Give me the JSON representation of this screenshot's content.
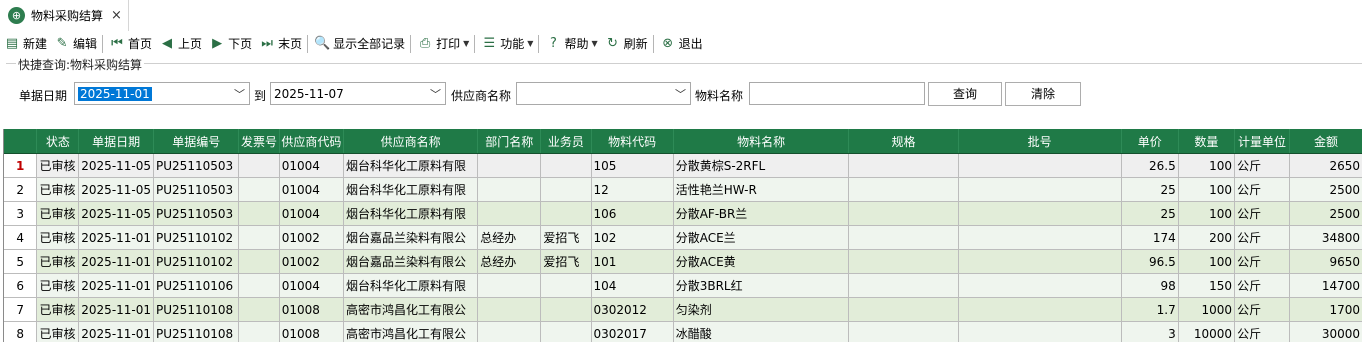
{
  "tab": {
    "title": "物料采购结算",
    "close": "×"
  },
  "toolbar": [
    {
      "label": "新建",
      "icon": "new-doc-icon",
      "glyph": "▤"
    },
    {
      "label": "编辑",
      "icon": "edit-icon",
      "glyph": "✎"
    },
    {
      "sep": true
    },
    {
      "label": "首页",
      "icon": "first-page-icon",
      "glyph": "⏮"
    },
    {
      "label": "上页",
      "icon": "prev-page-icon",
      "glyph": "◀"
    },
    {
      "label": "下页",
      "icon": "next-page-icon",
      "glyph": "▶"
    },
    {
      "label": "末页",
      "icon": "last-page-icon",
      "glyph": "⏭"
    },
    {
      "sep": true
    },
    {
      "label": "显示全部记录",
      "icon": "show-all-icon",
      "glyph": "🔍"
    },
    {
      "sep": true
    },
    {
      "label": "打印",
      "icon": "print-icon",
      "glyph": "⎙",
      "dropdown": true
    },
    {
      "sep": true
    },
    {
      "label": "功能",
      "icon": "function-icon",
      "glyph": "☰",
      "dropdown": true
    },
    {
      "sep": true
    },
    {
      "label": "帮助",
      "icon": "help-icon",
      "glyph": "?",
      "dropdown": true
    },
    {
      "label": "刷新",
      "icon": "refresh-icon",
      "glyph": "↻"
    },
    {
      "sep": true
    },
    {
      "label": "退出",
      "icon": "exit-icon",
      "glyph": "⊗"
    }
  ],
  "query": {
    "group_title": "快捷查询:物料采购结算",
    "date_label": "单据日期",
    "date_from": "2025-11-01",
    "to_label": "到",
    "date_to": "2025-11-07",
    "supplier_label": "供应商名称",
    "supplier_value": "",
    "material_label": "物料名称",
    "material_value": "",
    "search_btn": "查询",
    "clear_btn": "清除"
  },
  "grid": {
    "columns": [
      "状态",
      "单据日期",
      "单据编号",
      "发票号",
      "供应商代码",
      "供应商名称",
      "部门名称",
      "业务员",
      "物料代码",
      "物料名称",
      "规格",
      "批号",
      "单价",
      "数量",
      "计量单位",
      "金额"
    ],
    "rows": [
      {
        "no": "1",
        "cells": [
          "已审核",
          "2025-11-05",
          "PU25110503",
          "",
          "01004",
          "烟台科华化工原料有限",
          "",
          "",
          "105",
          "分散黄棕S-2RFL",
          "",
          "",
          "26.5",
          "100",
          "公斤",
          "2650"
        ]
      },
      {
        "no": "2",
        "cells": [
          "已审核",
          "2025-11-05",
          "PU25110503",
          "",
          "01004",
          "烟台科华化工原料有限",
          "",
          "",
          "12",
          "活性艳兰HW-R",
          "",
          "",
          "25",
          "100",
          "公斤",
          "2500"
        ]
      },
      {
        "no": "3",
        "cells": [
          "已审核",
          "2025-11-05",
          "PU25110503",
          "",
          "01004",
          "烟台科华化工原料有限",
          "",
          "",
          "106",
          "分散AF-BR兰",
          "",
          "",
          "25",
          "100",
          "公斤",
          "2500"
        ]
      },
      {
        "no": "4",
        "cells": [
          "已审核",
          "2025-11-01",
          "PU25110102",
          "",
          "01002",
          "烟台嘉品兰染料有限公",
          "总经办",
          "爱招飞",
          "102",
          "分散ACE兰",
          "",
          "",
          "174",
          "200",
          "公斤",
          "34800"
        ]
      },
      {
        "no": "5",
        "cells": [
          "已审核",
          "2025-11-01",
          "PU25110102",
          "",
          "01002",
          "烟台嘉品兰染料有限公",
          "总经办",
          "爱招飞",
          "101",
          "分散ACE黄",
          "",
          "",
          "96.5",
          "100",
          "公斤",
          "9650"
        ]
      },
      {
        "no": "6",
        "cells": [
          "已审核",
          "2025-11-01",
          "PU25110106",
          "",
          "01004",
          "烟台科华化工原料有限",
          "",
          "",
          "104",
          "分散3BRL红",
          "",
          "",
          "98",
          "150",
          "公斤",
          "14700"
        ]
      },
      {
        "no": "7",
        "cells": [
          "已审核",
          "2025-11-01",
          "PU25110108",
          "",
          "01008",
          "高密市鸿昌化工有限公",
          "",
          "",
          "0302012",
          "匀染剂",
          "",
          "",
          "1.7",
          "1000",
          "公斤",
          "1700"
        ]
      },
      {
        "no": "8",
        "cells": [
          "已审核",
          "2025-11-01",
          "PU25110108",
          "",
          "01008",
          "高密市鸿昌化工有限公",
          "",
          "",
          "0302017",
          "冰醋酸",
          "",
          "",
          "3",
          "10000",
          "公斤",
          "30000"
        ]
      }
    ]
  }
}
